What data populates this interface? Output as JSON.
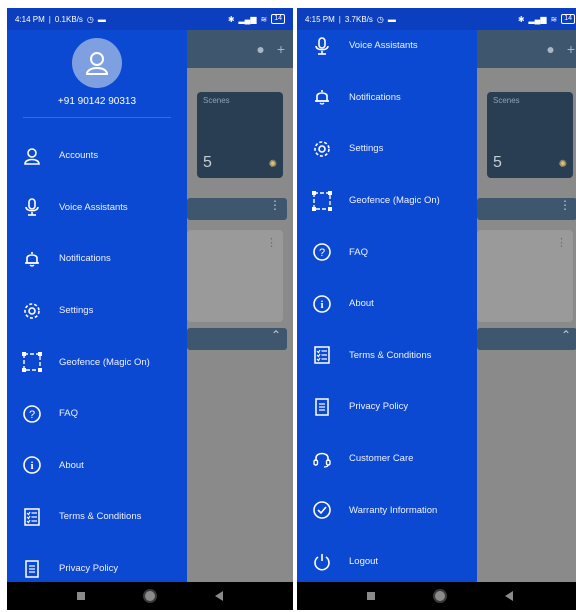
{
  "left_screen": {
    "status": {
      "time": "4:14 PM",
      "speed": "0.1KB/s",
      "battery": "14"
    },
    "profile": {
      "phone": "+91 90142 90313"
    },
    "background": {
      "scenes_label": "Scenes",
      "scenes_count": "5"
    },
    "menu": [
      {
        "label": "Accounts",
        "icon": "user-icon"
      },
      {
        "label": "Voice Assistants",
        "icon": "microphone-icon"
      },
      {
        "label": "Notifications",
        "icon": "bell-icon"
      },
      {
        "label": "Settings",
        "icon": "gear-icon"
      },
      {
        "label": "Geofence (Magic On)",
        "icon": "geofence-icon"
      },
      {
        "label": "FAQ",
        "icon": "question-icon"
      },
      {
        "label": "About",
        "icon": "info-icon"
      },
      {
        "label": "Terms & Conditions",
        "icon": "checklist-icon"
      },
      {
        "label": "Privacy Policy",
        "icon": "document-icon"
      }
    ]
  },
  "right_screen": {
    "status": {
      "time": "4:15 PM",
      "speed": "3.7KB/s",
      "battery": "14"
    },
    "background": {
      "scenes_label": "Scenes",
      "scenes_count": "5"
    },
    "menu": [
      {
        "label": "Voice Assistants",
        "icon": "microphone-icon"
      },
      {
        "label": "Notifications",
        "icon": "bell-icon"
      },
      {
        "label": "Settings",
        "icon": "gear-icon"
      },
      {
        "label": "Geofence (Magic On)",
        "icon": "geofence-icon"
      },
      {
        "label": "FAQ",
        "icon": "question-icon"
      },
      {
        "label": "About",
        "icon": "info-icon"
      },
      {
        "label": "Terms & Conditions",
        "icon": "checklist-icon"
      },
      {
        "label": "Privacy Policy",
        "icon": "document-icon"
      },
      {
        "label": "Customer Care",
        "icon": "headset-icon"
      },
      {
        "label": "Warranty Information",
        "icon": "badge-check-icon"
      },
      {
        "label": "Logout",
        "icon": "power-icon"
      }
    ]
  },
  "colors": {
    "drawer": "#0c49d3",
    "status_bar": "#0c3fc0",
    "overlay": "#8a8a8a"
  }
}
